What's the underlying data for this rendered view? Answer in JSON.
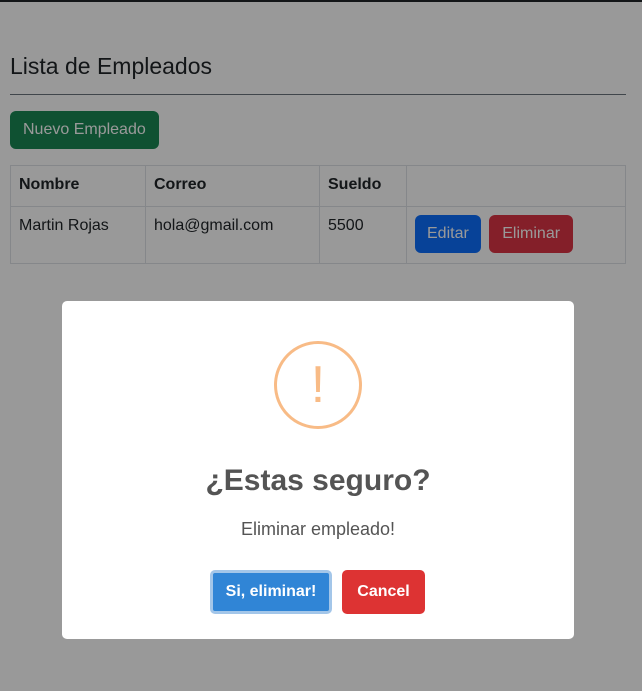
{
  "page": {
    "title": "Lista de Empleados",
    "new_button_label": "Nuevo Empleado"
  },
  "table": {
    "headers": [
      "Nombre",
      "Correo",
      "Sueldo",
      ""
    ],
    "rows": [
      {
        "nombre": "Martin Rojas",
        "correo": "hola@gmail.com",
        "sueldo": "5500",
        "edit_label": "Editar",
        "delete_label": "Eliminar"
      }
    ]
  },
  "dialog": {
    "icon": "warning-exclamation-icon",
    "icon_glyph": "!",
    "title": "¿Estas seguro?",
    "text": "Eliminar empleado!",
    "confirm_label": "Si, eliminar!",
    "cancel_label": "Cancel"
  },
  "colors": {
    "success": "#198754",
    "primary": "#0d6efd",
    "danger": "#dc3545",
    "confirm": "#3085d6",
    "cancel": "#dd3333",
    "warning_icon": "#f8bb86"
  }
}
